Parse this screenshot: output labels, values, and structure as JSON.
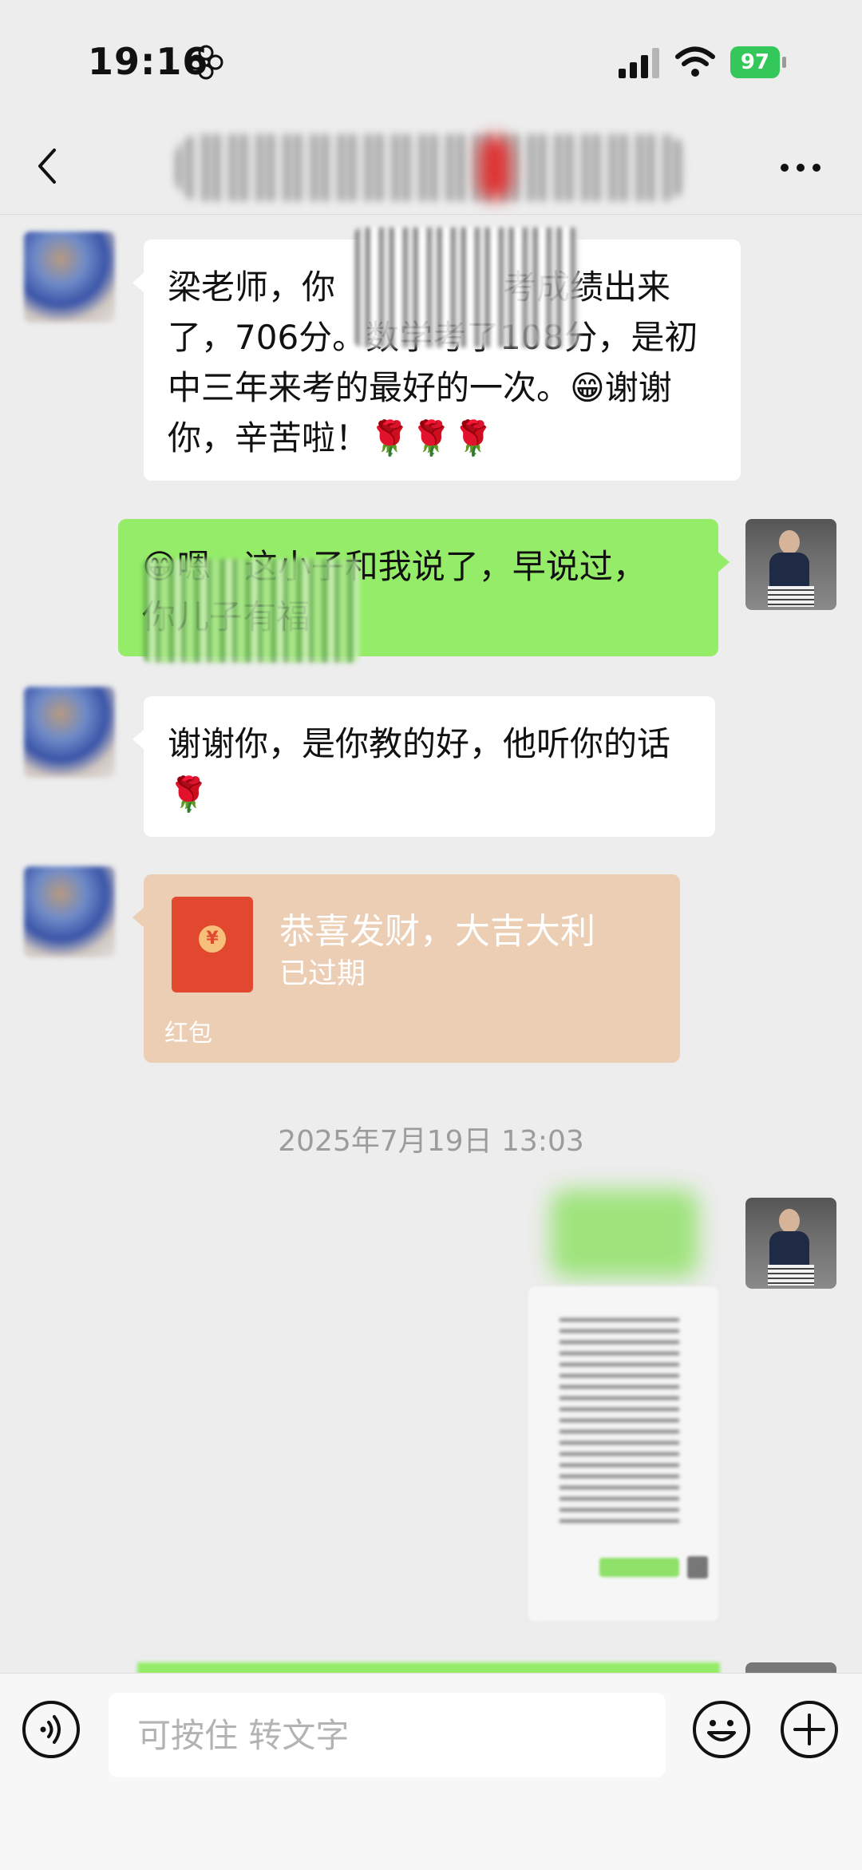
{
  "status_bar": {
    "time": "19:16",
    "battery": "97",
    "icons": [
      "flower-icon",
      "signal-icon",
      "wifi-icon",
      "battery-icon"
    ]
  },
  "nav": {
    "back_icon": "chevron-left-icon",
    "title": "",
    "more_icon": "more-dots-icon"
  },
  "messages": [
    {
      "side": "left",
      "text": "梁老师，你　　　　　考成绩出来了，706分。数学考了108分，是初中三年来考的最好的一次。😁谢谢你，辛苦啦！🌹🌹🌹"
    },
    {
      "side": "right",
      "text": "😁嗯　这小子和我说了，早说过，　　　　　　　你儿子有福"
    },
    {
      "side": "left",
      "text": "谢谢你，是你教的好，他听你的话🌹"
    }
  ],
  "red_packet": {
    "title": "恭喜发财，大吉大利",
    "status": "已过期",
    "footer": "红包",
    "coin_symbol": "¥"
  },
  "timestamp": "2025年7月19日 13:03",
  "input_bar": {
    "voice_icon": "voice-icon",
    "placeholder": "可按住 转文字",
    "emoji_icon": "emoji-icon",
    "plus_icon": "plus-icon"
  },
  "colors": {
    "background": "#ededed",
    "my_bubble": "#95ec69",
    "other_bubble": "#ffffff",
    "red_packet": "#ecceb4",
    "battery": "#34c759"
  }
}
